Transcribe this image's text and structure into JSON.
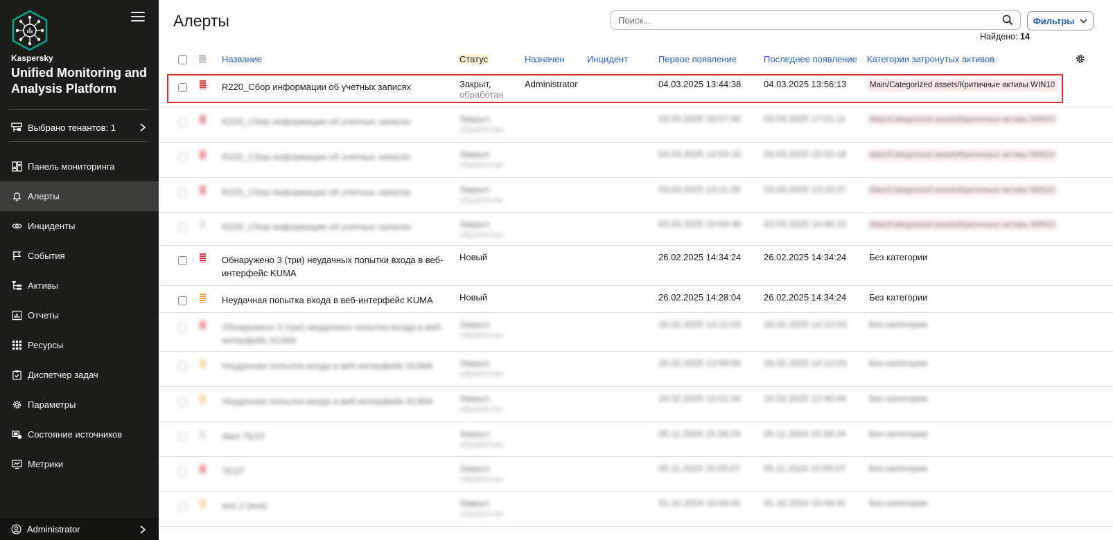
{
  "sidebar": {
    "brand": "Kaspersky",
    "product": "Unified Monitoring and Analysis Platform",
    "tenant": "Выбрано тенантов: 1",
    "items": [
      {
        "label": "Панель мониторинга",
        "icon": "dashboard-icon"
      },
      {
        "label": "Алерты",
        "icon": "bell-icon",
        "active": true
      },
      {
        "label": "Инциденты",
        "icon": "eye-icon"
      },
      {
        "label": "События",
        "icon": "flag-icon"
      },
      {
        "label": "Активы",
        "icon": "tree-icon"
      },
      {
        "label": "Отчеты",
        "icon": "report-icon"
      },
      {
        "label": "Ресурсы",
        "icon": "grid-icon"
      },
      {
        "label": "Диспетчер задач",
        "icon": "task-icon"
      },
      {
        "label": "Параметры",
        "icon": "gear-icon"
      },
      {
        "label": "Состояние источников",
        "icon": "source-icon"
      },
      {
        "label": "Метрики",
        "icon": "metrics-icon"
      }
    ],
    "user": "Administrator"
  },
  "header": {
    "title": "Алерты",
    "search_placeholder": "Поиск...",
    "filters_label": "Фильтры",
    "found_label": "Найдено:",
    "found_count": "14"
  },
  "table": {
    "columns": {
      "name": "Название",
      "status": "Статус",
      "assigned": "Назначен",
      "incident": "Инцидент",
      "first_seen": "Первое появление",
      "last_seen": "Последнее появление",
      "categories": "Категории затронутых активов"
    },
    "rows": [
      {
        "name": "R220_Сбор информации об учетных записях",
        "status": "Закрыт,",
        "status2": "обработан",
        "assigned": "Administrator",
        "first": "04.03.2025 13:44:38",
        "last": "04.03.2025 13:56:13",
        "category": "Main/Categorized assets/Критичные активы WIN10",
        "sev": "red",
        "cat_tag": true,
        "blurred": false
      },
      {
        "name": "R220_Сбор информации об учетных записях",
        "status": "Закрыт,",
        "status2": "обработан",
        "assigned": "",
        "first": "03.03.2025 16:57:00",
        "last": "03.03.2025 17:01:11",
        "category": "Main/Categorized assets/Критичные активы WIN10",
        "sev": "red-solid",
        "cat_tag": true,
        "blurred": true
      },
      {
        "name": "R220_Сбор информации об учетных записях",
        "status": "Закрыт,",
        "status2": "обработан",
        "assigned": "",
        "first": "03.03.2025 14:54:10",
        "last": "03.03.2025 15:02:18",
        "category": "Main/Categorized assets/Критичные активы WIN10",
        "sev": "red-solid",
        "cat_tag": true,
        "blurred": true
      },
      {
        "name": "R220_Сбор информации об учетных записях",
        "status": "Закрыт,",
        "status2": "обработан",
        "assigned": "",
        "first": "03.03.2025 13:11:29",
        "last": "03.03.2025 13:15:27",
        "category": "Main/Categorized assets/Критичные активы WIN10",
        "sev": "red-solid",
        "cat_tag": true,
        "blurred": true
      },
      {
        "name": "R220_Сбор информации об учетных записях",
        "status": "Закрыт,",
        "status2": "обработан",
        "assigned": "",
        "first": "03.03.2025 10:04:36",
        "last": "03.03.2025 10:49:23",
        "category": "Main/Categorized assets/Критичные активы WIN10",
        "sev": "grey",
        "cat_tag": true,
        "blurred": true
      },
      {
        "name": "Обнаружено 3 (три) неудачных попытки входа в веб-интерфейс KUMA",
        "status": "Новый",
        "status2": "",
        "assigned": "",
        "first": "26.02.2025 14:34:24",
        "last": "26.02.2025 14:34:24",
        "category": "Без категории",
        "sev": "red",
        "cat_tag": false,
        "blurred": false
      },
      {
        "name": "Неудачная попытка входа в веб-интерфейс KUMA",
        "status": "Новый",
        "status2": "",
        "assigned": "",
        "first": "26.02.2025 14:28:04",
        "last": "26.02.2025 14:34:24",
        "category": "Без категории",
        "sev": "orange",
        "cat_tag": false,
        "blurred": false
      },
      {
        "name": "Обнаружено 3 (три) неудачных попытки входа в веб-интерфейс KUMA",
        "status": "Закрыт,",
        "status2": "обработан",
        "assigned": "",
        "first": "26.02.2025 14:12:03",
        "last": "26.02.2025 14:12:03",
        "category": "Без категории",
        "sev": "red-solid",
        "cat_tag": false,
        "blurred": true
      },
      {
        "name": "Неудачная попытка входа в веб-интерфейс KUMA",
        "status": "Закрыт,",
        "status2": "обработан",
        "assigned": "",
        "first": "26.02.2025 13:58:00",
        "last": "26.02.2025 14:12:03",
        "category": "Без категории",
        "sev": "orange",
        "cat_tag": false,
        "blurred": true
      },
      {
        "name": "Неудачная попытка входа в веб-интерфейс KUMA",
        "status": "Закрыт,",
        "status2": "обработан",
        "assigned": "",
        "first": "24.02.2025 12:01:44",
        "last": "24.02.2025 12:40:44",
        "category": "Без категории",
        "sev": "orange",
        "cat_tag": false,
        "blurred": true
      },
      {
        "name": "Alert TEST",
        "status": "Закрыт,",
        "status2": "обработан",
        "assigned": "",
        "first": "05.11.2024 15:28:24",
        "last": "05.11.2024 15:28:24",
        "category": "Без категории",
        "sev": "grey",
        "cat_tag": false,
        "blurred": true
      },
      {
        "name": "TEST",
        "status": "Закрыт,",
        "status2": "обработан",
        "assigned": "",
        "first": "05.11.2024 15:05:07",
        "last": "05.11.2024 15:05:07",
        "category": "Без категории",
        "sev": "red-solid",
        "cat_tag": false,
        "blurred": true
      },
      {
        "name": "test 2 (test)",
        "status": "Закрыт,",
        "status2": "обработан",
        "assigned": "",
        "first": "31.10.2024 10:44:41",
        "last": "31.10.2024 10:44:41",
        "category": "Без категории",
        "sev": "orange",
        "cat_tag": false,
        "blurred": true
      }
    ]
  }
}
